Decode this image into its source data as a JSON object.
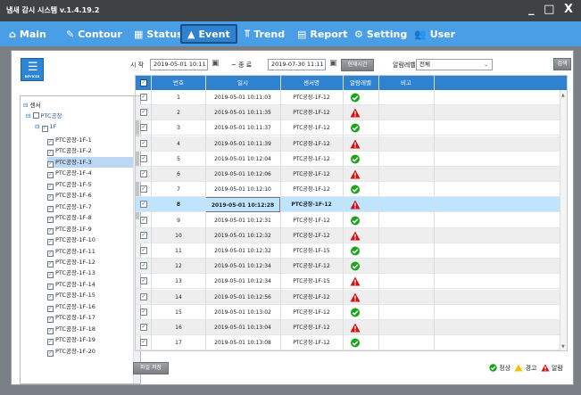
{
  "window": {
    "title": "냄새 감시 시스템 v.1.4.19.2",
    "controls": "_ □ X"
  },
  "menu": [
    {
      "label": "Main",
      "icon": "home-icon",
      "glyph": "⌂"
    },
    {
      "label": "Contour",
      "icon": "contour-icon",
      "glyph": "✎"
    },
    {
      "label": "Status",
      "icon": "grid-icon",
      "glyph": "▦"
    },
    {
      "label": "Event",
      "icon": "warning-icon",
      "glyph": "▲"
    },
    {
      "label": "Trend",
      "icon": "trend-icon",
      "glyph": "⫪"
    },
    {
      "label": "Report",
      "icon": "report-icon",
      "glyph": "▤"
    },
    {
      "label": "Setting",
      "icon": "gear-icon",
      "glyph": "⚙"
    },
    {
      "label": "User",
      "icon": "users-icon",
      "glyph": "👥"
    }
  ],
  "active_menu": "Event",
  "devices_button": {
    "label": "DEVICES"
  },
  "tree": {
    "root": "센서",
    "factory": "PTC공장",
    "floor": "1F",
    "sensors": [
      "PTC공장-1F-1",
      "PTC공장-1F-2",
      "PTC공장-1F-3",
      "PTC공장-1F-4",
      "PTC공장-1F-5",
      "PTC공장-1F-6",
      "PTC공장-1F-7",
      "PTC공장-1F-8",
      "PTC공장-1F-9",
      "PTC공장-1F-10",
      "PTC공장-1F-11",
      "PTC공장-1F-12",
      "PTC공장-1F-13",
      "PTC공장-1F-14",
      "PTC공장-1F-15",
      "PTC공장-1F-16",
      "PTC공장-1F-17",
      "PTC공장-1F-18",
      "PTC공장-1F-19",
      "PTC공장-1F-20"
    ],
    "selected": "PTC공장-1F-3"
  },
  "filter": {
    "start_label": "시 작",
    "start_value": "2019-05-01 10:11",
    "separator": "~ 종 료",
    "end_value": "2019-07-30 11:11",
    "now_button": "현재시간",
    "level_label": "알람레벨",
    "level_value": "전체",
    "search_button": "검색"
  },
  "table": {
    "headers": [
      "번호",
      "일시",
      "센서명",
      "알람레벨",
      "비고"
    ],
    "rows": [
      {
        "no": "1",
        "datetime": "2019-05-01 10:11:03",
        "sensor": "PTC공장-1F-12",
        "level": "normal"
      },
      {
        "no": "2",
        "datetime": "2019-05-01 10:11:35",
        "sensor": "PTC공장-1F-12",
        "level": "alarm"
      },
      {
        "no": "3",
        "datetime": "2019-05-01 10:11:37",
        "sensor": "PTC공장-1F-12",
        "level": "normal"
      },
      {
        "no": "4",
        "datetime": "2019-05-01 10:11:39",
        "sensor": "PTC공장-1F-12",
        "level": "alarm"
      },
      {
        "no": "5",
        "datetime": "2019-05-01 10:12:04",
        "sensor": "PTC공장-1F-12",
        "level": "normal"
      },
      {
        "no": "6",
        "datetime": "2019-05-01 10:12:06",
        "sensor": "PTC공장-1F-12",
        "level": "alarm"
      },
      {
        "no": "7",
        "datetime": "2019-05-01 10:12:10",
        "sensor": "PTC공장-1F-12",
        "level": "normal"
      },
      {
        "no": "8",
        "datetime": "2019-05-01 10:12:28",
        "sensor": "PTC공장-1F-12",
        "level": "alarm"
      },
      {
        "no": "9",
        "datetime": "2019-05-01 10:12:31",
        "sensor": "PTC공장-1F-12",
        "level": "normal"
      },
      {
        "no": "10",
        "datetime": "2019-05-01 10:12:32",
        "sensor": "PTC공장-1F-12",
        "level": "alarm"
      },
      {
        "no": "11",
        "datetime": "2019-05-01 10:12:32",
        "sensor": "PTC공장-1F-15",
        "level": "normal"
      },
      {
        "no": "12",
        "datetime": "2019-05-01 10:12:34",
        "sensor": "PTC공장-1F-12",
        "level": "normal"
      },
      {
        "no": "13",
        "datetime": "2019-05-01 10:12:34",
        "sensor": "PTC공장-1F-15",
        "level": "alarm"
      },
      {
        "no": "14",
        "datetime": "2019-05-01 10:12:56",
        "sensor": "PTC공장-1F-12",
        "level": "alarm"
      },
      {
        "no": "15",
        "datetime": "2019-05-01 10:13:02",
        "sensor": "PTC공장-1F-12",
        "level": "normal"
      },
      {
        "no": "16",
        "datetime": "2019-05-01 10:13:04",
        "sensor": "PTC공장-1F-12",
        "level": "alarm"
      },
      {
        "no": "17",
        "datetime": "2019-05-01 10:13:08",
        "sensor": "PTC공장-1F-12",
        "level": "normal"
      }
    ],
    "selected_row": "8"
  },
  "save_button": "파일 저장",
  "legend": {
    "normal": "정상",
    "warning": "경고",
    "alarm": "알람"
  },
  "colors": {
    "menu_bg": "#4a9ee6",
    "header_bg": "#2e82cf",
    "normal": "#1aa51a",
    "warning": "#f2c200",
    "alarm": "#d41010",
    "selected_row": "#bfe4ff"
  }
}
